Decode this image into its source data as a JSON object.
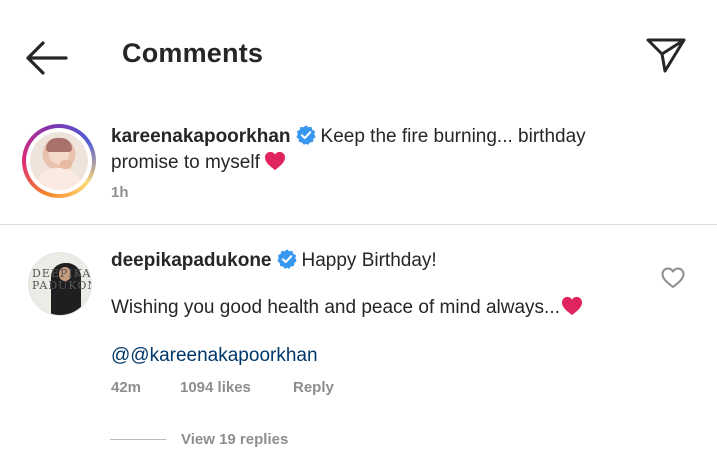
{
  "header": {
    "title": "Comments",
    "back_icon": "arrow-left-icon",
    "share_icon": "paper-plane-icon"
  },
  "caption": {
    "username": "kareenakapoorkhan",
    "verified": true,
    "text_line1": "Keep the fire burning... birthday",
    "text_line2": "promise to myself",
    "emoji": "red-heart",
    "time": "1h"
  },
  "comment": {
    "username": "deepikapadukone",
    "verified": true,
    "line1": "Happy Birthday!",
    "line2": "Wishing you good health and peace of mind always...",
    "emoji": "red-heart",
    "mention": "@@kareenakapoorkhan",
    "time": "42m",
    "likes": "1094 likes",
    "reply_label": "Reply",
    "view_replies": "View 19 replies",
    "avatar_logo_line1": "DEEPIKA",
    "avatar_logo_line2": "PADUKONE"
  },
  "colors": {
    "verified_blue": "#3897f0",
    "heart_red": "#e0245e",
    "mention_blue": "#00376b",
    "meta_gray": "#8e8e8e"
  }
}
